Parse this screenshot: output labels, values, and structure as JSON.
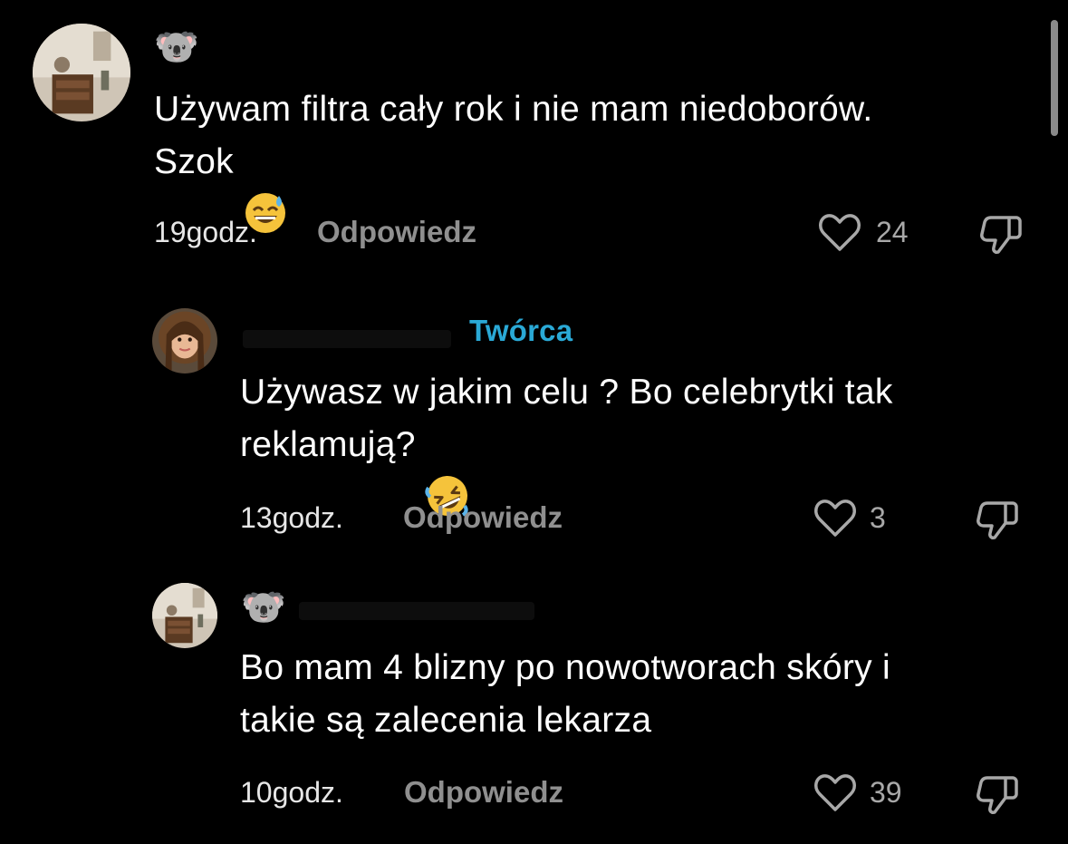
{
  "comments": [
    {
      "time": "19godz.",
      "reply_label": "Odpowiedz",
      "text": "Używam filtra cały rok i nie mam niedoborów.\nSzok",
      "emoji": "sweat-smile",
      "likes": "24",
      "name_emoji": "🐨"
    },
    {
      "badge": "Twórca",
      "time": "13godz.",
      "reply_label": "Odpowiedz",
      "text": "Używasz w jakim celu ? Bo celebrytki tak\nreklamują?",
      "emoji": "rofl",
      "likes": "3"
    },
    {
      "time": "10godz.",
      "reply_label": "Odpowiedz",
      "text": "Bo mam 4 blizny po nowotworach skóry i\ntakie są zalecenia lekarza",
      "likes": "39",
      "name_emoji": "🐨"
    }
  ],
  "colors": {
    "background": "#000000",
    "creator_badge": "#2aa9d6",
    "reply": "#8f8f8f"
  },
  "icons": {
    "like": "heart-outline-icon",
    "dislike": "thumbs-down-outline-icon"
  }
}
